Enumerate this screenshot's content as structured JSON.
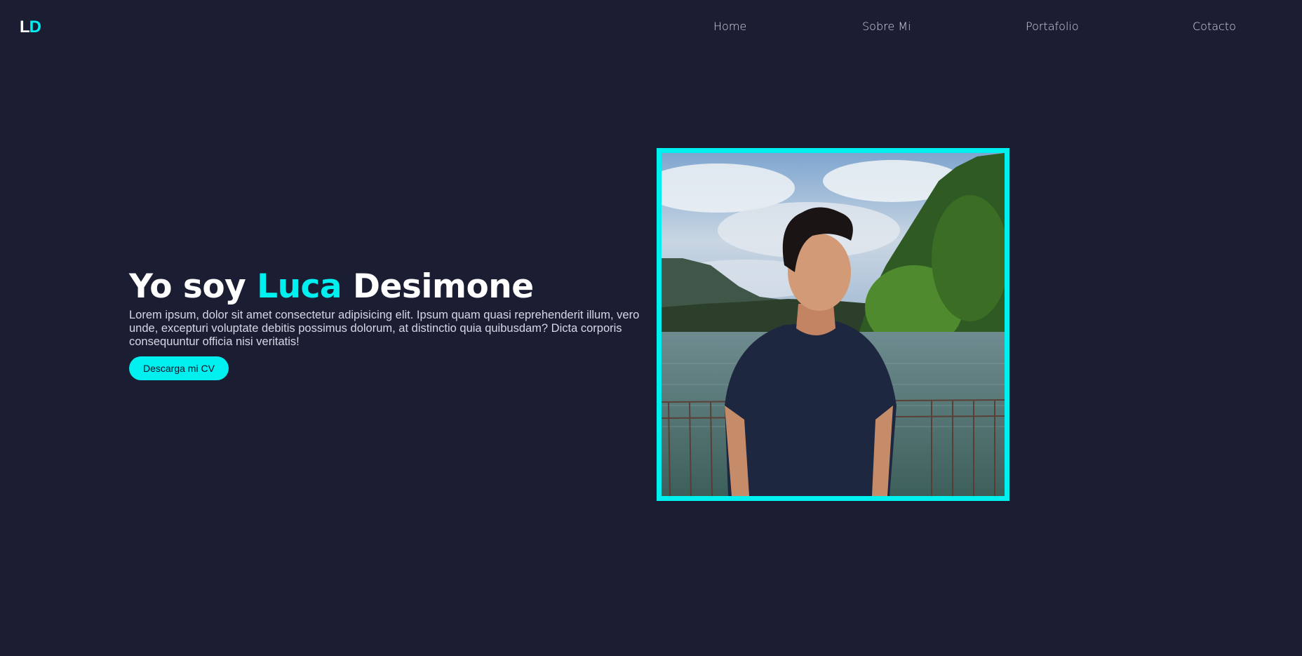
{
  "nav": {
    "logo": {
      "first": "L",
      "second": "D"
    },
    "links": [
      {
        "label": "Home"
      },
      {
        "label": "Sobre Mi"
      },
      {
        "label": "Portafolio"
      },
      {
        "label": "Cotacto"
      }
    ]
  },
  "hero": {
    "title_prefix": "Yo soy ",
    "title_first_name": "Luca",
    "title_last_name": " Desimone",
    "description": "Lorem ipsum, dolor sit amet consectetur adipisicing elit. Ipsum quam quasi reprehenderit illum, vero unde, excepturi voluptate debitis possimus dolorum, at distinctio quia quibusdam? Dicta corporis consequuntur officia nisi veritatis!",
    "cta_label": "Descarga mi CV"
  },
  "colors": {
    "background": "#1b1d33",
    "accent": "#00f0f0",
    "text": "#ffffff",
    "muted_text": "#d6d8e6"
  }
}
